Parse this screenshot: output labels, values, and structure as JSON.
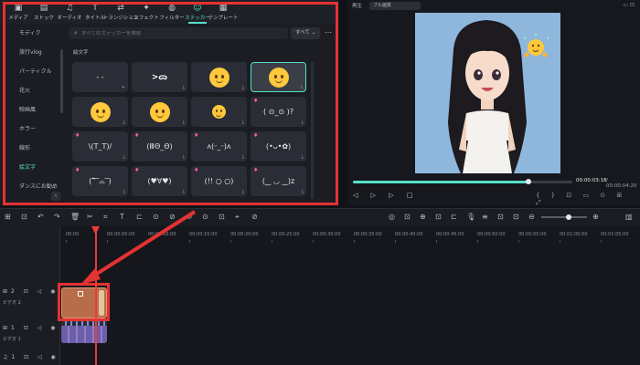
{
  "top_tabs": [
    {
      "icon": "▣",
      "label": "メディア"
    },
    {
      "icon": "▤",
      "label": "ストック"
    },
    {
      "icon": "♫",
      "label": "オーディオ"
    },
    {
      "icon": "T",
      "label": "タイトル"
    },
    {
      "icon": "⇄",
      "label": "トランジション"
    },
    {
      "icon": "✦",
      "label": "エフェクト"
    },
    {
      "icon": "◍",
      "label": "フィルター"
    },
    {
      "icon": "☺",
      "label": "ステッカー"
    },
    {
      "icon": "▦",
      "label": "テンプレート"
    }
  ],
  "active_tab_index": 7,
  "categories": [
    {
      "label": "モディク"
    },
    {
      "label": "旅行vlog"
    },
    {
      "label": "パーティクル"
    },
    {
      "label": "花火"
    },
    {
      "label": "映画風"
    },
    {
      "label": "ホラー"
    },
    {
      "label": "線形"
    },
    {
      "label": "絵文字"
    },
    {
      "label": "ダンスにお勧め"
    }
  ],
  "active_category_index": 7,
  "search": {
    "placeholder": "すべてのステッカーを検索"
  },
  "filter": {
    "label": "すべて ⌄"
  },
  "more": "⋯",
  "section_title": "絵文字",
  "stickers": [
    {
      "text": "‐ ‐",
      "kind": "kaomoji",
      "badge": "+"
    },
    {
      "text": "",
      "kind": "angry"
    },
    {
      "text": "",
      "kind": "face"
    },
    {
      "text": "",
      "kind": "face",
      "selected": true
    },
    {
      "text": "",
      "kind": "face"
    },
    {
      "text": "",
      "kind": "face"
    },
    {
      "text": "",
      "kind": "face-small"
    },
    {
      "text": "( ⊙_⊙ )?",
      "kind": "kaomoji",
      "gem": true
    },
    {
      "text": "\\(T_T)/",
      "kind": "kaomoji",
      "gem": true
    },
    {
      "text": "(ⅢΘ_Θ)",
      "kind": "kaomoji",
      "gem": true
    },
    {
      "text": "ʌ(ᵕ_ᵕ)ʌ",
      "kind": "kaomoji",
      "gem": true
    },
    {
      "text": "(•ᴗ•✿)",
      "kind": "kaomoji",
      "gem": true
    },
    {
      "text": "(‾᷅‾⌓‾)",
      "kind": "kaomoji",
      "gem": true
    },
    {
      "text": "(♥∀♥)",
      "kind": "kaomoji",
      "gem": true
    },
    {
      "text": "(!! ○ ○)",
      "kind": "kaomoji",
      "gem": true
    },
    {
      "text": "(‿ ◡ ‿)z",
      "kind": "kaomoji",
      "gem": true
    }
  ],
  "collapse": "‹",
  "preview": {
    "playback_label": "再生",
    "quality": "フル画質",
    "window_buttons": "▭ ⊡",
    "current_time": "00:00:03:18",
    "total_time": "/ 00:00:04:20",
    "progress": 0.8,
    "controls": "◁ ▷ ▷ □",
    "right_controls": "{ } ⊡ ▭ ⊙ ⊞ ⤢"
  },
  "toolbar": {
    "left_icons": [
      "⊞",
      "⊡",
      "↶",
      "↷",
      "🗑",
      "✂",
      "⌗",
      "T",
      "⊏",
      "⊙",
      "⊘",
      "⟲",
      "⊙",
      "⊡",
      "⌖",
      "⊘"
    ],
    "right_icons": [
      "◎",
      "⊡",
      "⊕",
      "⊡",
      "⊏",
      "🎙",
      "≡",
      "⊡",
      "⊡",
      "⊖"
    ],
    "zoom_level": 0.6,
    "zoom_plus": "⊕",
    "view_icon": "▥"
  },
  "timeline": {
    "ruler_labels": [
      "00:00",
      "00:00:05:00",
      "00:00:10:00",
      "00:00:15:00",
      "00:00:20:00",
      "00:00:25:00",
      "00:00:30:00",
      "00:00:35:00",
      "00:00:40:00",
      "00:00:45:00",
      "00:00:50:00",
      "00:00:55:00",
      "00:01:00:00",
      "00:01:05:00"
    ],
    "tracks": [
      {
        "icons": "⊞2 ⊡ ◁ ◉",
        "name": "ビデオ 2"
      },
      {
        "icons": "⊞1 ⊡ ◁ ◉",
        "name": "ビデオ 1"
      },
      {
        "icons": "♫1 ⊡ ◁ ◉",
        "name": "オーディオ 1"
      }
    ]
  }
}
